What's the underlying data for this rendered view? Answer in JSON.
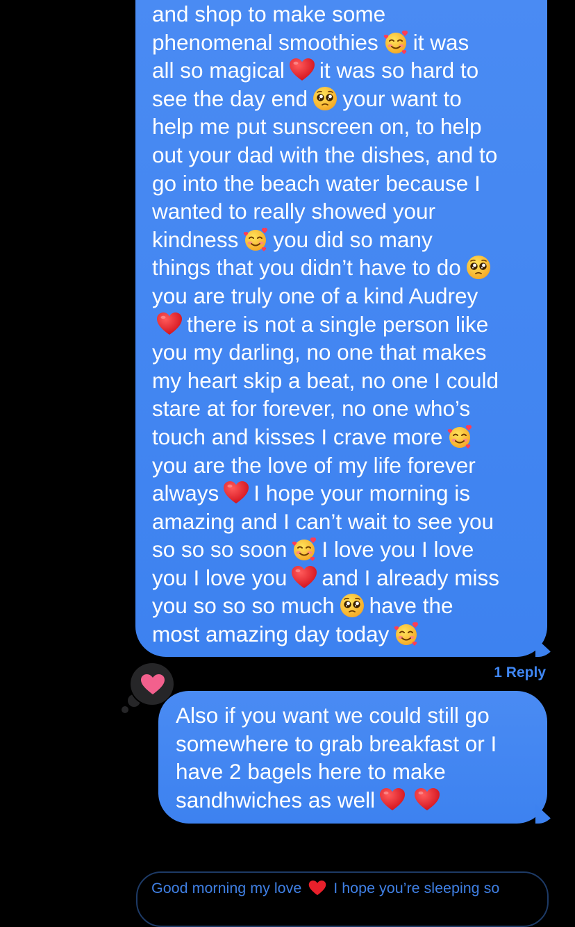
{
  "main_message": {
    "lines": [
      [
        {
          "t": "and shop to make some"
        }
      ],
      [
        {
          "t": "phenomenal smoothies"
        },
        {
          "e": "smiling-face-with-hearts"
        },
        {
          "t": "it was"
        }
      ],
      [
        {
          "t": "all so magical"
        },
        {
          "e": "red-heart"
        },
        {
          "t": "it was so hard to"
        }
      ],
      [
        {
          "t": "see the day end"
        },
        {
          "e": "pleading-face"
        },
        {
          "t": "your want to"
        }
      ],
      [
        {
          "t": "help me put sunscreen on, to help"
        }
      ],
      [
        {
          "t": "out your dad with the dishes, and to"
        }
      ],
      [
        {
          "t": "go into the beach water because I"
        }
      ],
      [
        {
          "t": "wanted to really showed your"
        }
      ],
      [
        {
          "t": "kindness"
        },
        {
          "e": "smiling-face-with-hearts"
        },
        {
          "t": "you did so many"
        }
      ],
      [
        {
          "t": "things that you didn’t have to do"
        },
        {
          "e": "pleading-face"
        }
      ],
      [
        {
          "t": "you are truly one of a kind Audrey"
        }
      ],
      [
        {
          "e": "red-heart"
        },
        {
          "t": "there is not a single person like"
        }
      ],
      [
        {
          "t": "you my darling, no one that makes"
        }
      ],
      [
        {
          "t": "my heart skip a beat, no one I could"
        }
      ],
      [
        {
          "t": "stare at for forever, no one who’s"
        }
      ],
      [
        {
          "t": "touch and kisses I crave more"
        },
        {
          "e": "smiling-face-with-hearts"
        }
      ],
      [
        {
          "t": "you are the love of my life forever"
        }
      ],
      [
        {
          "t": "always"
        },
        {
          "e": "red-heart"
        },
        {
          "t": "I hope your morning is"
        }
      ],
      [
        {
          "t": "amazing and I can’t wait to see you"
        }
      ],
      [
        {
          "t": "so so so soon"
        },
        {
          "e": "smiling-face-with-hearts"
        },
        {
          "t": "I love you I love"
        }
      ],
      [
        {
          "t": "you I love you"
        },
        {
          "e": "red-heart"
        },
        {
          "t": "and I already miss"
        }
      ],
      [
        {
          "t": "you so so so much"
        },
        {
          "e": "pleading-face"
        },
        {
          "t": "have the"
        }
      ],
      [
        {
          "t": "most amazing day today"
        },
        {
          "e": "smiling-face-with-hearts"
        }
      ]
    ]
  },
  "reply_count": "1 Reply",
  "tapback": {
    "icon": "heart",
    "color": "#f3608d"
  },
  "reply_message": {
    "lines": [
      [
        {
          "t": "Also if you want we could still go"
        }
      ],
      [
        {
          "t": "somewhere to grab breakfast or I"
        }
      ],
      [
        {
          "t": "have 2 bagels here to make"
        }
      ],
      [
        {
          "t": "sandhwiches as well"
        },
        {
          "e": "red-heart"
        },
        {
          "e": "red-heart"
        }
      ]
    ]
  },
  "preview_message": {
    "before": "Good morning my love",
    "after": "I hope you’re sleeping so"
  },
  "colors": {
    "bubble_blue": "#3d82f0",
    "background": "#000000",
    "reply_link": "#3f86f2"
  }
}
